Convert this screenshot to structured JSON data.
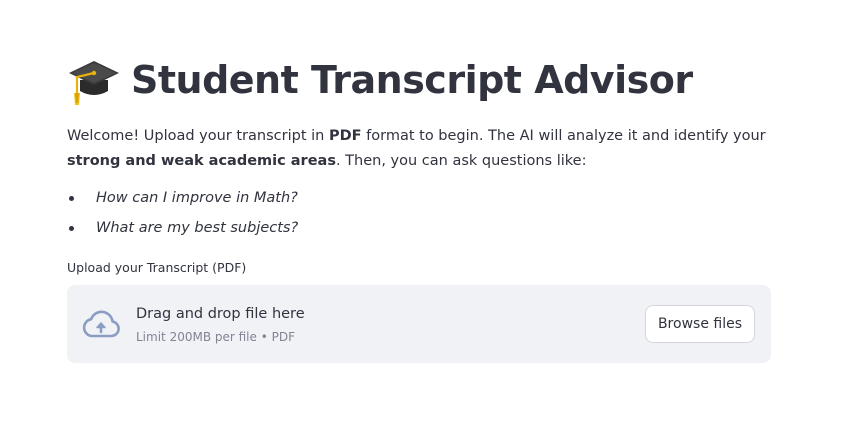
{
  "header": {
    "icon": "graduation-cap-icon",
    "title": "Student Transcript Advisor"
  },
  "intro": {
    "part1": "Welcome! Upload your transcript in ",
    "bold1": "PDF",
    "part2": " format to begin. The AI will analyze it and identify your ",
    "bold2": "strong and weak academic areas",
    "part3": ". Then, you can ask questions like:"
  },
  "examples": [
    "How can I improve in Math?",
    "What are my best subjects?"
  ],
  "uploader": {
    "label": "Upload your Transcript (PDF)",
    "icon": "cloud-upload-icon",
    "drop_text": "Drag and drop file here",
    "limit_text": "Limit 200MB per file • PDF",
    "browse_label": "Browse files"
  },
  "colors": {
    "text": "#31333f",
    "muted_text": "#808495",
    "dropzone_bg": "#f0f2f6",
    "cloud_icon": "#8b9dc3"
  }
}
